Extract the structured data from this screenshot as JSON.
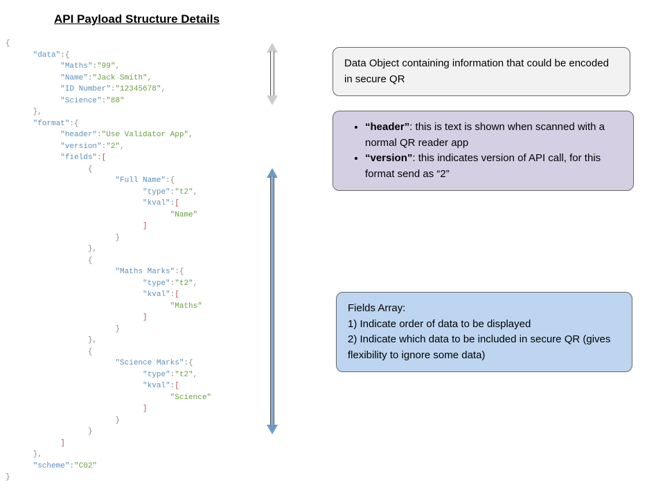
{
  "title": "API Payload Structure Details",
  "code": {
    "data_key": "\"data\"",
    "maths_key": "\"Maths\"",
    "maths_val": "\"99\"",
    "name_key": "\"Name\"",
    "name_val": "\"Jack Smith\"",
    "id_key": "\"ID Number\"",
    "id_val": "\"12345678\"",
    "science_key": "\"Science\"",
    "science_val": "\"88\"",
    "format_key": "\"format\"",
    "header_key": "\"header\"",
    "header_val": "\"Use Validator App\"",
    "version_key": "\"version\"",
    "version_val": "\"2\"",
    "fields_key": "\"fields\"",
    "fullname_key": "\"Full Name\"",
    "type_key": "\"type\"",
    "type_val": "\"t2\"",
    "kval_key": "\"kval\"",
    "kval_name": "\"Name\"",
    "mathsmarks_key": "\"Maths Marks\"",
    "kval_maths": "\"Maths\"",
    "sciencemarks_key": "\"Science Marks\"",
    "kval_science": "\"Science\"",
    "scheme_key": "\"scheme\"",
    "scheme_val": "\"C02\""
  },
  "callouts": {
    "c1": "Data Object containing information that could be encoded in  secure QR",
    "c2_header_label": "“header”",
    "c2_header_text": ": this is text is shown when scanned with a normal QR reader app",
    "c2_version_label": "“version”",
    "c2_version_text": ":  this indicates version of API call, for this format send as  “2”",
    "c3_title": "Fields Array:",
    "c3_l1": "1) Indicate order of data to be displayed",
    "c3_l2": "2) Indicate which data to be included in secure QR (gives flexibility to ignore some data)"
  }
}
